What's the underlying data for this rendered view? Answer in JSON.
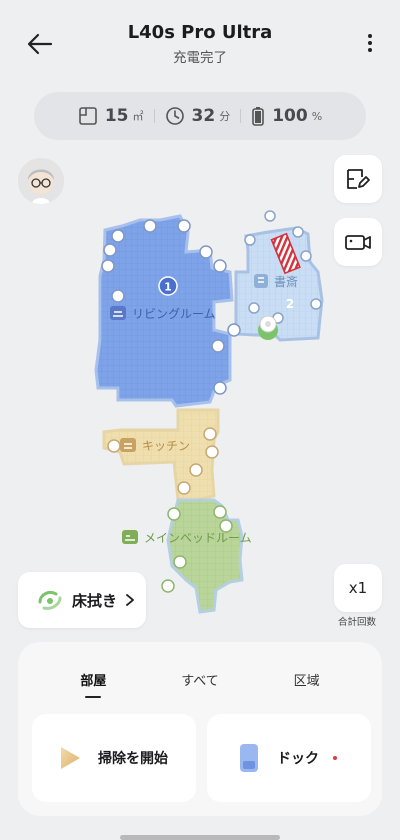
{
  "header": {
    "title": "L40s Pro Ultra",
    "status": "充電完了"
  },
  "stats": {
    "area_value": "15",
    "area_unit": "㎡",
    "time_value": "32",
    "time_unit": "分",
    "battery_value": "100",
    "battery_unit": "%"
  },
  "map": {
    "rooms": [
      {
        "name": "リビングルーム",
        "color": "#7fa3e8"
      },
      {
        "name": "書斎",
        "color": "#c9def4"
      },
      {
        "name": "キッチン",
        "color": "#f0dfae"
      },
      {
        "name": "メインベッドルーム",
        "color": "#b9d59a"
      }
    ],
    "order_marker_1": "1",
    "order_marker_2": "2"
  },
  "mop": {
    "label": "床拭き"
  },
  "count": {
    "value": "x1",
    "label": "合計回数"
  },
  "tabs": [
    {
      "label": "部屋"
    },
    {
      "label": "すべて"
    },
    {
      "label": "区域"
    }
  ],
  "actions": {
    "start_label": "掃除を開始",
    "dock_label": "ドック"
  },
  "colors": {
    "accent_blue": "#6f97e6",
    "start_icon": "#e8c78a",
    "dock_icon": "#8fb0ee",
    "dot_red": "#e03a3a",
    "mop_green": "#7bc46a"
  }
}
